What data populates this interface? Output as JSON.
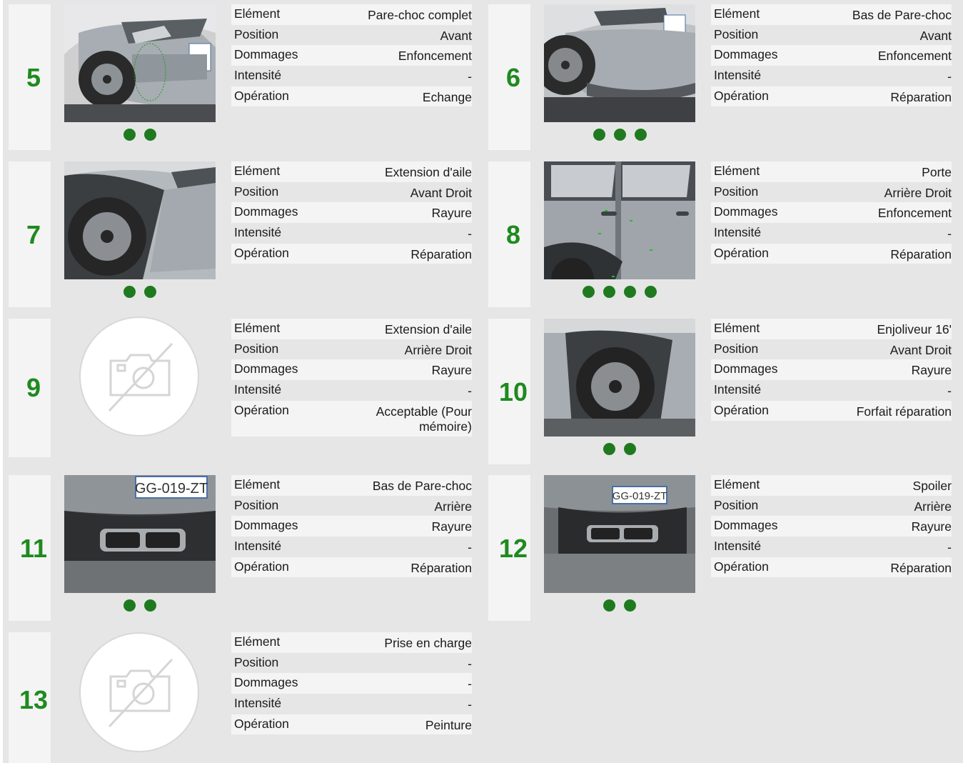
{
  "labels": {
    "element": "Elément",
    "position": "Position",
    "dommages": "Dommages",
    "intensite": "Intensité",
    "operation": "Opération"
  },
  "items": [
    {
      "num": "5",
      "element": "Pare-choc complet",
      "position": "Avant",
      "dommages": "Enfoncement",
      "intensite": "-",
      "operation": "Echange",
      "photo": "front-bumper-photo",
      "dots": 2
    },
    {
      "num": "6",
      "element": "Bas de Pare-choc",
      "position": "Avant",
      "dommages": "Enfoncement",
      "intensite": "-",
      "operation": "Réparation",
      "photo": "front-lower-bumper-photo",
      "dots": 3
    },
    {
      "num": "7",
      "element": "Extension d'aile",
      "position": "Avant Droit",
      "dommages": "Rayure",
      "intensite": "-",
      "operation": "Réparation",
      "photo": "front-right-wheel-arch-photo",
      "dots": 2
    },
    {
      "num": "8",
      "element": "Porte",
      "position": "Arrière Droit",
      "dommages": "Enfoncement",
      "intensite": "-",
      "operation": "Réparation",
      "photo": "rear-right-door-photo",
      "dots": 4
    },
    {
      "num": "9",
      "element": "Extension d'aile",
      "position": "Arrière Droit",
      "dommages": "Rayure",
      "intensite": "-",
      "operation": "Acceptable (Pour mémoire)",
      "photo": "no-photo",
      "dots": 0
    },
    {
      "num": "10",
      "element": "Enjoliveur 16'",
      "position": "Avant Droit",
      "dommages": "Rayure",
      "intensite": "-",
      "operation": "Forfait réparation",
      "photo": "front-right-wheel-photo",
      "dots": 2
    },
    {
      "num": "11",
      "element": "Bas de Pare-choc",
      "position": "Arrière",
      "dommages": "Rayure",
      "intensite": "-",
      "operation": "Réparation",
      "photo": "rear-bumper-photo",
      "dots": 2
    },
    {
      "num": "12",
      "element": "Spoiler",
      "position": "Arrière",
      "dommages": "Rayure",
      "intensite": "-",
      "operation": "Réparation",
      "photo": "rear-spoiler-photo",
      "dots": 2
    },
    {
      "num": "13",
      "element": "Prise en charge",
      "position": "-",
      "dommages": "-",
      "intensite": "-",
      "operation": "Peinture",
      "photo": "no-photo",
      "dots": 0
    }
  ],
  "plate_text": "GG-019-ZT",
  "colors": {
    "accent": "#1e8a1e",
    "dot": "#1f7a1f",
    "background": "#e6e6e6"
  }
}
